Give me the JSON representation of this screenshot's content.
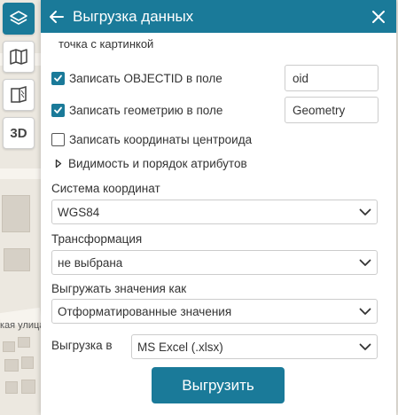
{
  "map": {
    "street_label": "кая улица"
  },
  "toolbar": {
    "btn_3d_label": "3D"
  },
  "panel": {
    "title": "Выгрузка данных",
    "subtitle": "точка с картинкой",
    "options": {
      "write_objectid": {
        "label": "Записать OBJECTID в поле",
        "checked": true,
        "field_value": "oid"
      },
      "write_geometry": {
        "label": "Записать геометрию в поле",
        "checked": true,
        "field_value": "Geometry"
      },
      "write_centroid": {
        "label": "Записать координаты центроида",
        "checked": false
      }
    },
    "attributes_expander": "Видимость и порядок атрибутов",
    "coordinate_system": {
      "label": "Система координат",
      "value": "WGS84"
    },
    "transformation": {
      "label": "Трансформация",
      "value": "не выбрана"
    },
    "export_values": {
      "label": "Выгружать значения как",
      "value": "Отформатированные значения"
    },
    "export_to": {
      "label": "Выгрузка в",
      "value": "MS Excel (.xlsx)"
    },
    "submit_label": "Выгрузить"
  },
  "colors": {
    "accent": "#1a7a99",
    "header_text": "#ffffff"
  }
}
